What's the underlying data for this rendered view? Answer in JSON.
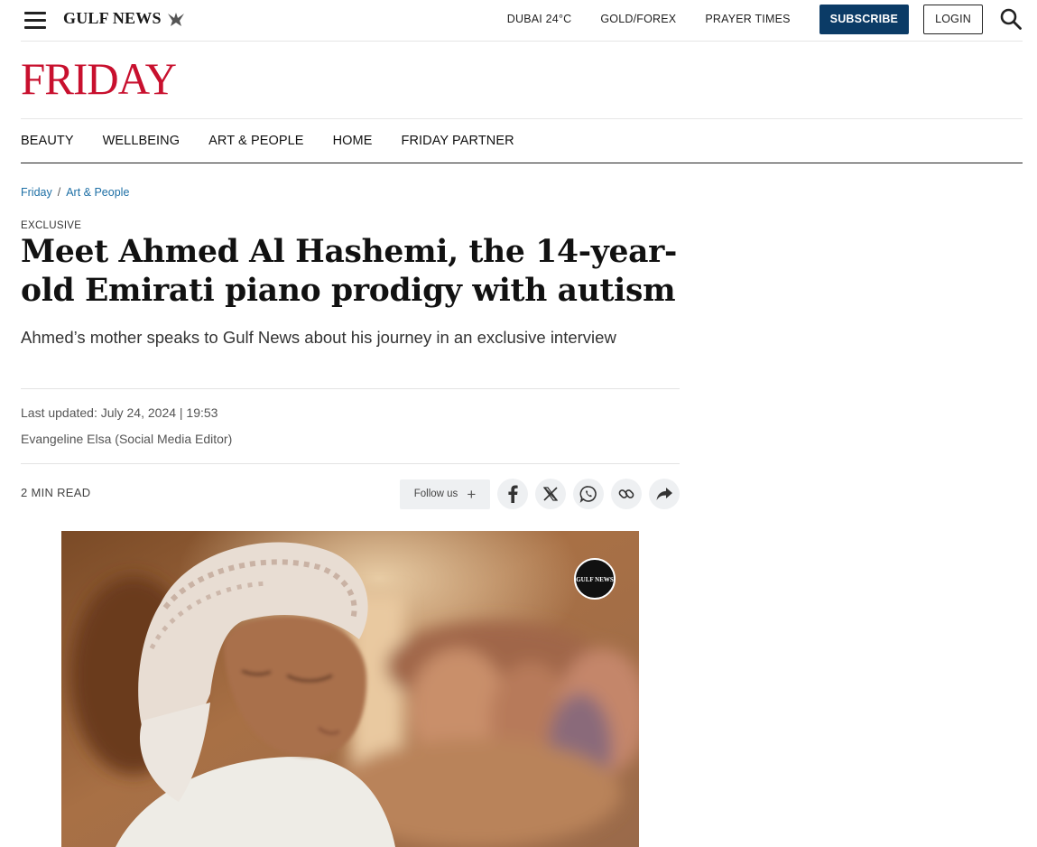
{
  "header": {
    "brand": "GULF NEWS",
    "links": [
      "DUBAI 24°C",
      "GOLD/FOREX",
      "PRAYER TIMES"
    ],
    "subscribe_label": "SUBSCRIBE",
    "login_label": "LOGIN"
  },
  "masthead": {
    "title": "FRIDAY"
  },
  "nav": {
    "items": [
      "BEAUTY",
      "WELLBEING",
      "ART & PEOPLE",
      "HOME",
      "FRIDAY PARTNER"
    ]
  },
  "breadcrumb": {
    "items": [
      "Friday",
      "Art & People"
    ],
    "separator": "/"
  },
  "article": {
    "kicker": "EXCLUSIVE",
    "headline": "Meet Ahmed Al Hashemi, the 14-year-old Emirati piano prodigy with autism",
    "standfirst": "Ahmed’s mother speaks to Gulf News about his journey in an exclusive interview",
    "last_updated": "Last updated: July 24, 2024 | 19:53",
    "author": "Evangeline Elsa (Social Media Editor)",
    "read_time": "2 MIN READ"
  },
  "share": {
    "follow_label": "Follow us",
    "follow_plus": "+",
    "icons": [
      "facebook-icon",
      "x-icon",
      "whatsapp-icon",
      "copy-link-icon",
      "share-icon"
    ]
  },
  "hero": {
    "watermark": "GULF NEWS"
  },
  "colors": {
    "masthead_red": "#c8102e",
    "subscribe_blue": "#0b3b66",
    "breadcrumb_blue": "#1d6fa5"
  }
}
